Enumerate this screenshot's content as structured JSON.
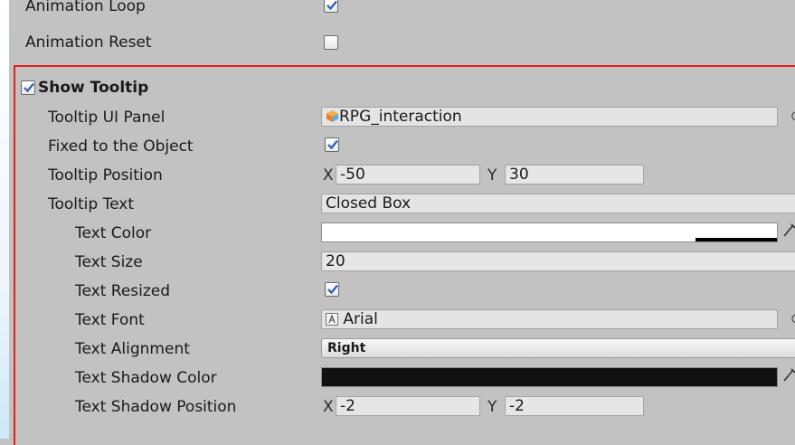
{
  "rows": {
    "animation_loop": {
      "label": "Animation Loop",
      "checked": true
    },
    "animation_reset": {
      "label": "Animation Reset",
      "checked": false
    },
    "show_tooltip": {
      "label": "Show Tooltip",
      "checked": true
    },
    "tooltip_ui_panel": {
      "label": "Tooltip UI Panel",
      "value": "RPG_interaction",
      "icon": "prefab-cube-icon"
    },
    "fixed_to_object": {
      "label": "Fixed to the Object",
      "checked": true
    },
    "tooltip_position": {
      "label": "Tooltip Position",
      "x_axis": "X",
      "x": "-50",
      "y_axis": "Y",
      "y": "30"
    },
    "tooltip_text": {
      "label": "Tooltip Text",
      "value": "Closed Box"
    },
    "text_color": {
      "label": "Text Color",
      "color": "#ffffff"
    },
    "text_size": {
      "label": "Text Size",
      "value": "20"
    },
    "text_resized": {
      "label": "Text Resized",
      "checked": true
    },
    "text_font": {
      "label": "Text Font",
      "value": "Arial",
      "icon": "font-asset-icon"
    },
    "text_alignment": {
      "label": "Text Alignment",
      "value": "Right"
    },
    "text_shadow_color": {
      "label": "Text Shadow Color",
      "color": "#111111"
    },
    "text_shadow_position": {
      "label": "Text Shadow Position",
      "x_axis": "X",
      "x": "-2",
      "y_axis": "Y",
      "y": "-2"
    }
  },
  "colors": {
    "background": "#c2c2c2",
    "highlight_border": "#e0201c",
    "check_mark": "#2a5db0",
    "field_bg": "#e4e4e4"
  }
}
